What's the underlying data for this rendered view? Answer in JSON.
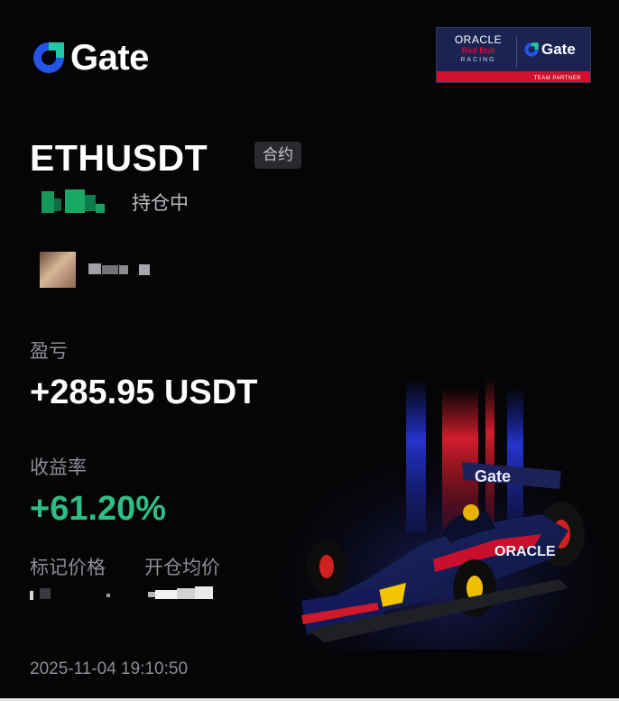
{
  "brand": {
    "name": "Gate",
    "accent": "#2354e6"
  },
  "partner_badge": {
    "oracle": "ORACLE",
    "redbull": "Red Bull",
    "racing": "RACING",
    "gate": "Gate",
    "footer": "TEAM PARTNER"
  },
  "position": {
    "symbol": "ETHUSDT",
    "type_tag": "合约",
    "status": "持仓中"
  },
  "pnl": {
    "label": "盈亏",
    "value": "+285.95 USDT"
  },
  "roi": {
    "label": "收益率",
    "value": "+61.20%",
    "color": "#2ebd85"
  },
  "prices": {
    "mark_label": "标记价格",
    "entry_label": "开仓均价"
  },
  "timestamp": "2025-11-04 19:10:50",
  "icons": {
    "logo": "gate-logo-icon",
    "car": "f1-car-icon"
  }
}
